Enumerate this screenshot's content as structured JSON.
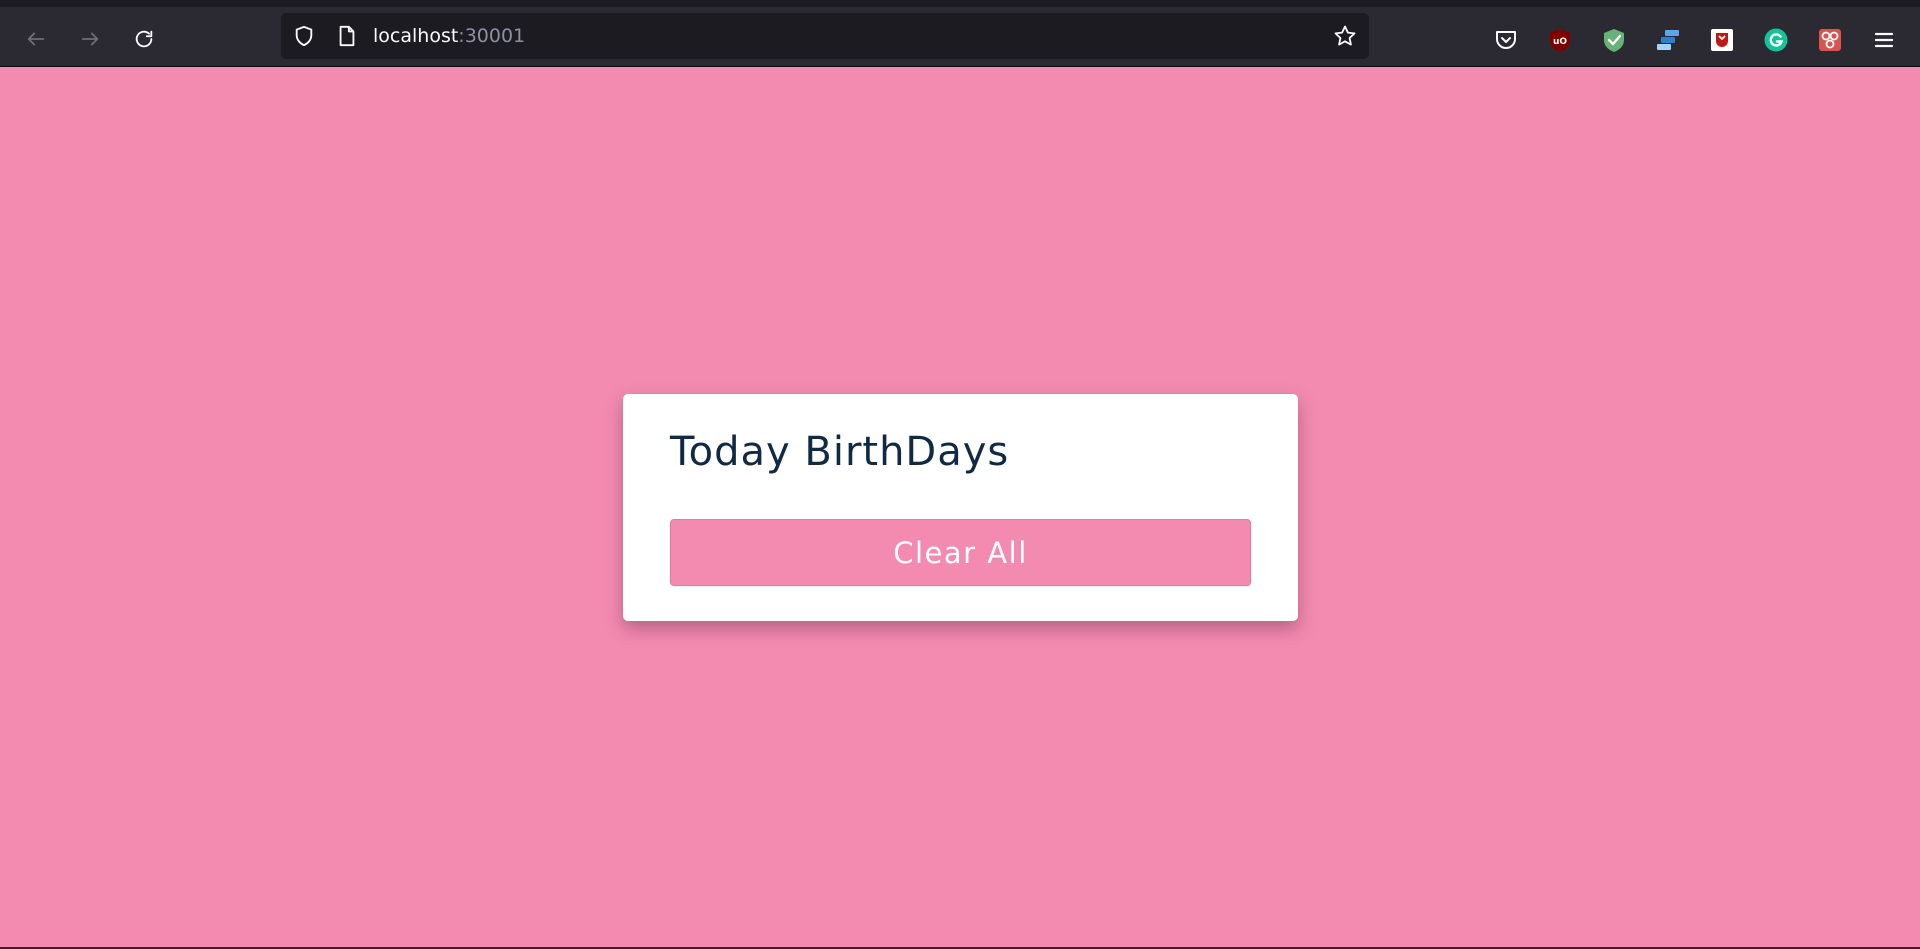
{
  "browser": {
    "url_host": "localhost",
    "url_port": ":30001",
    "toolbar_icons": {
      "back": "arrow-left-icon",
      "forward": "arrow-right-icon",
      "reload": "reload-icon",
      "tracking_protection": "shield-icon",
      "page_info": "page-icon",
      "bookmark": "star-icon"
    },
    "extensions": [
      "pocket-icon",
      "ublock-origin-icon",
      "adguard-icon",
      "stack-icon",
      "mcafee-icon",
      "grammarly-icon",
      "extension-puzzle-icon",
      "menu-icon"
    ]
  },
  "page": {
    "background_color": "#f38bb0",
    "card": {
      "title": "Today BirthDays",
      "clear_button_label": "Clear All",
      "button_color": "#f38bb0",
      "title_color": "#102a43"
    }
  }
}
